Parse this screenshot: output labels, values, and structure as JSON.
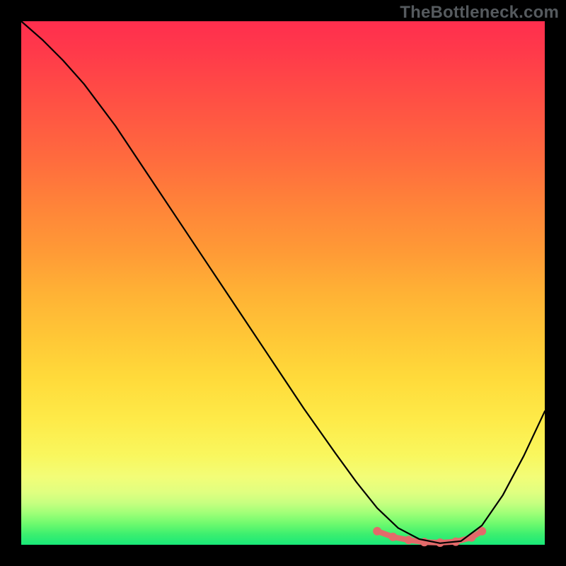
{
  "watermark": "TheBottleneck.com",
  "chart_data": {
    "type": "line",
    "title": "",
    "xlabel": "",
    "ylabel": "",
    "xlim": [
      0,
      100
    ],
    "ylim": [
      0,
      100
    ],
    "grid": false,
    "series": [
      {
        "name": "curve",
        "x": [
          0,
          4,
          8,
          12,
          18,
          24,
          30,
          36,
          42,
          48,
          54,
          60,
          64,
          68,
          72,
          76,
          80,
          84,
          88,
          92,
          96,
          100
        ],
        "values": [
          100,
          96.5,
          92.5,
          88,
          80,
          71,
          62,
          53,
          44,
          35,
          26,
          17.5,
          12,
          7,
          3.2,
          1.1,
          0.3,
          0.7,
          3.7,
          9.5,
          17,
          25.5
        ]
      }
    ],
    "highlight": {
      "name": "near-zero-band",
      "x_start": 68,
      "x_end": 88,
      "points": [
        {
          "x": 68,
          "y": 2.6
        },
        {
          "x": 71,
          "y": 1.5
        },
        {
          "x": 74,
          "y": 0.9
        },
        {
          "x": 77,
          "y": 0.5
        },
        {
          "x": 80,
          "y": 0.4
        },
        {
          "x": 83,
          "y": 0.6
        },
        {
          "x": 86,
          "y": 1.4
        },
        {
          "x": 88,
          "y": 2.6
        }
      ]
    },
    "colors": {
      "curve": "#000000",
      "highlight": "#e36a6a",
      "gradient_top": "#ff2e4e",
      "gradient_bottom": "#19e878"
    }
  }
}
